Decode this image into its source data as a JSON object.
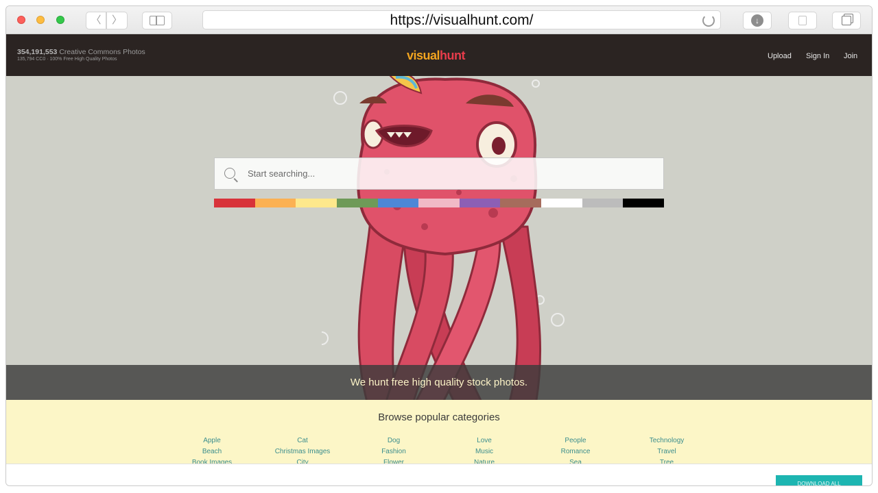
{
  "browser": {
    "url": "https://visualhunt.com/",
    "back_glyph": "〈",
    "forward_glyph": "〉"
  },
  "header": {
    "stats_count": "354,191,553",
    "stats_label": " Creative Commons Photos",
    "stats_sub": "135,794 CC0 · 100% Free High Quality Photos",
    "logo_visual": "visual",
    "logo_hunt": "hunt",
    "nav": [
      "Upload",
      "Sign In",
      "Join"
    ]
  },
  "search": {
    "placeholder": "Start searching..."
  },
  "colors": [
    "#d8333a",
    "#fbb153",
    "#fde88c",
    "#6e9a58",
    "#4d87d6",
    "#f1b9c6",
    "#8c5fb5",
    "#a66c5c",
    "#ffffff",
    "#bcbcbc",
    "#000000"
  ],
  "hero": {
    "tagline": "We hunt free high quality stock photos."
  },
  "categories": {
    "title": "Browse popular categories",
    "columns": [
      [
        "Apple",
        "Beach",
        "Book Images"
      ],
      [
        "Cat",
        "Christmas Images",
        "City"
      ],
      [
        "Dog",
        "Fashion",
        "Flower"
      ],
      [
        "Love",
        "Music",
        "Nature"
      ],
      [
        "People",
        "Romance",
        "Sea"
      ],
      [
        "Technology",
        "Travel",
        "Tree"
      ]
    ]
  },
  "download_all_label": "DOWNLOAD ALL"
}
